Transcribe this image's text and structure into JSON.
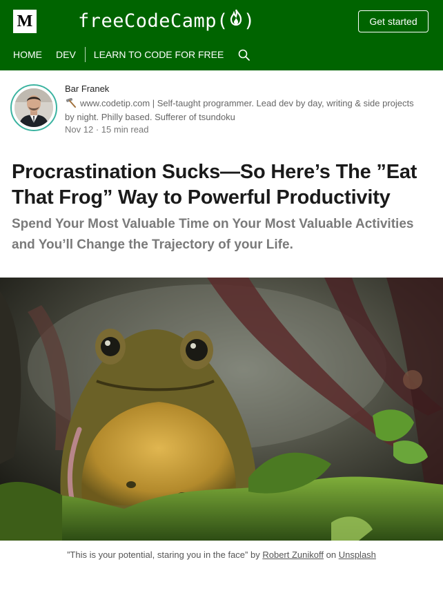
{
  "header": {
    "logo_letter": "M",
    "brand_text": "freeCodeCamp(",
    "brand_close": ")",
    "get_started_label": "Get started",
    "nav": [
      {
        "label": "HOME"
      },
      {
        "label": "DEV"
      },
      {
        "label": "LEARN TO CODE FOR FREE"
      }
    ],
    "colors": {
      "brand_green": "#006400"
    }
  },
  "author": {
    "name": "Bar Franek",
    "bio_icon": "hammer-icon",
    "bio": "www.codetip.com | Self-taught programmer. Lead dev by day, writing & side projects by night. Philly based. Sufferer of tsundoku",
    "date": "Nov 12",
    "separator": "·",
    "read_time": "15 min read"
  },
  "article": {
    "title": "Procrastination Sucks—So Here’s The ”Eat That Frog” Way to Powerful Productivity",
    "subtitle": "Spend Your Most Valuable Time on Your Most Valuable Activities and You’ll Change the Trajectory of your Life."
  },
  "caption": {
    "quote": "”This is your potential, staring you in the face” by",
    "photographer": "Robert Zunikoff",
    "on": "on",
    "source": "Unsplash"
  }
}
